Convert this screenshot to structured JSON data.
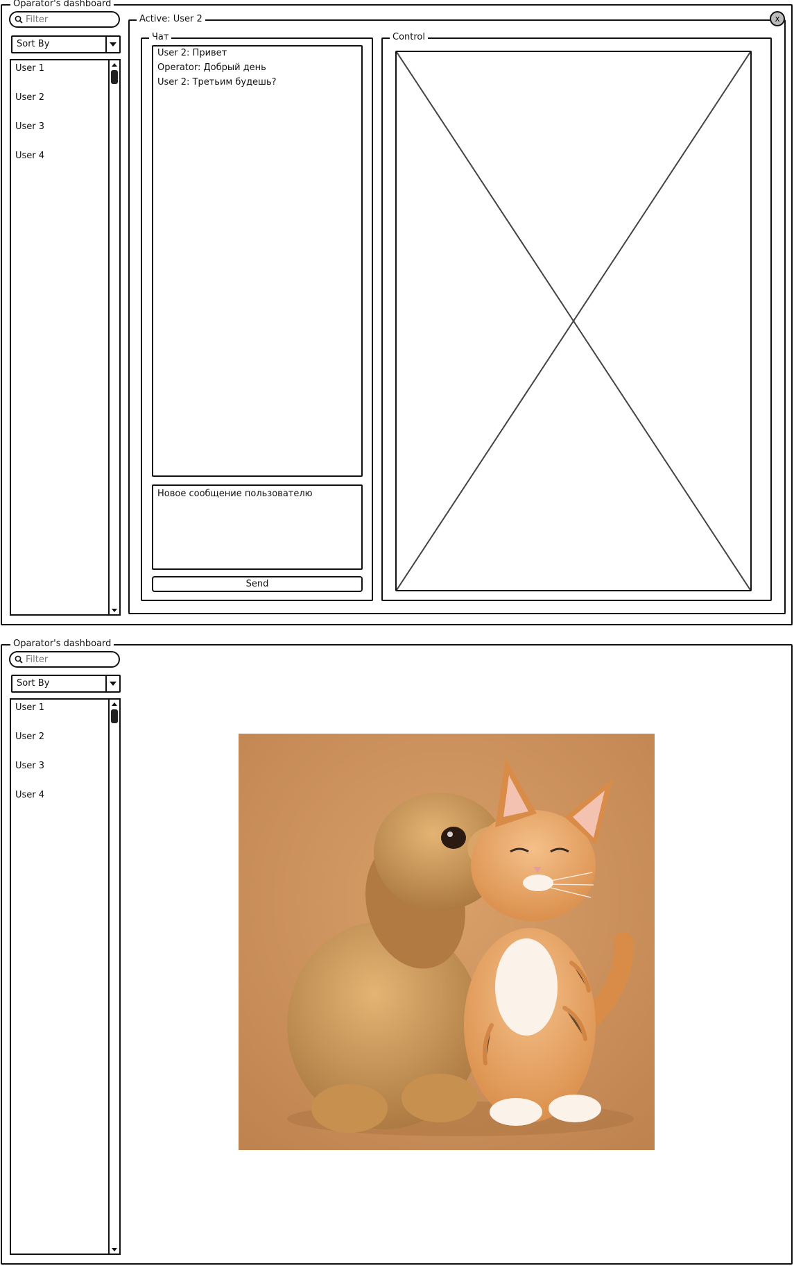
{
  "dashboard": {
    "title": "Oparator's dashboard",
    "filter_placeholder": "Filter",
    "sort_label": "Sort By",
    "users": [
      "User 1",
      "User 2",
      "User 3",
      "User 4"
    ]
  },
  "session": {
    "active_label": "Active: User 2",
    "close_label": "x",
    "chat": {
      "legend": "Чат",
      "messages": [
        "User 2: Привет",
        "Operator: Добрый день",
        "User 2: Третьим будешь?"
      ],
      "input_placeholder": "Новое сообщение пользователю",
      "send_label": "Send"
    },
    "control": {
      "legend": "Control"
    }
  },
  "icons": {
    "search": "search-icon",
    "dropdown": "chevron-down-icon",
    "scroll_up": "arrow-up-icon",
    "scroll_down": "arrow-down-icon",
    "close": "close-icon",
    "placeholder": "image-placeholder-icon"
  },
  "image": {
    "description_visible": false
  }
}
